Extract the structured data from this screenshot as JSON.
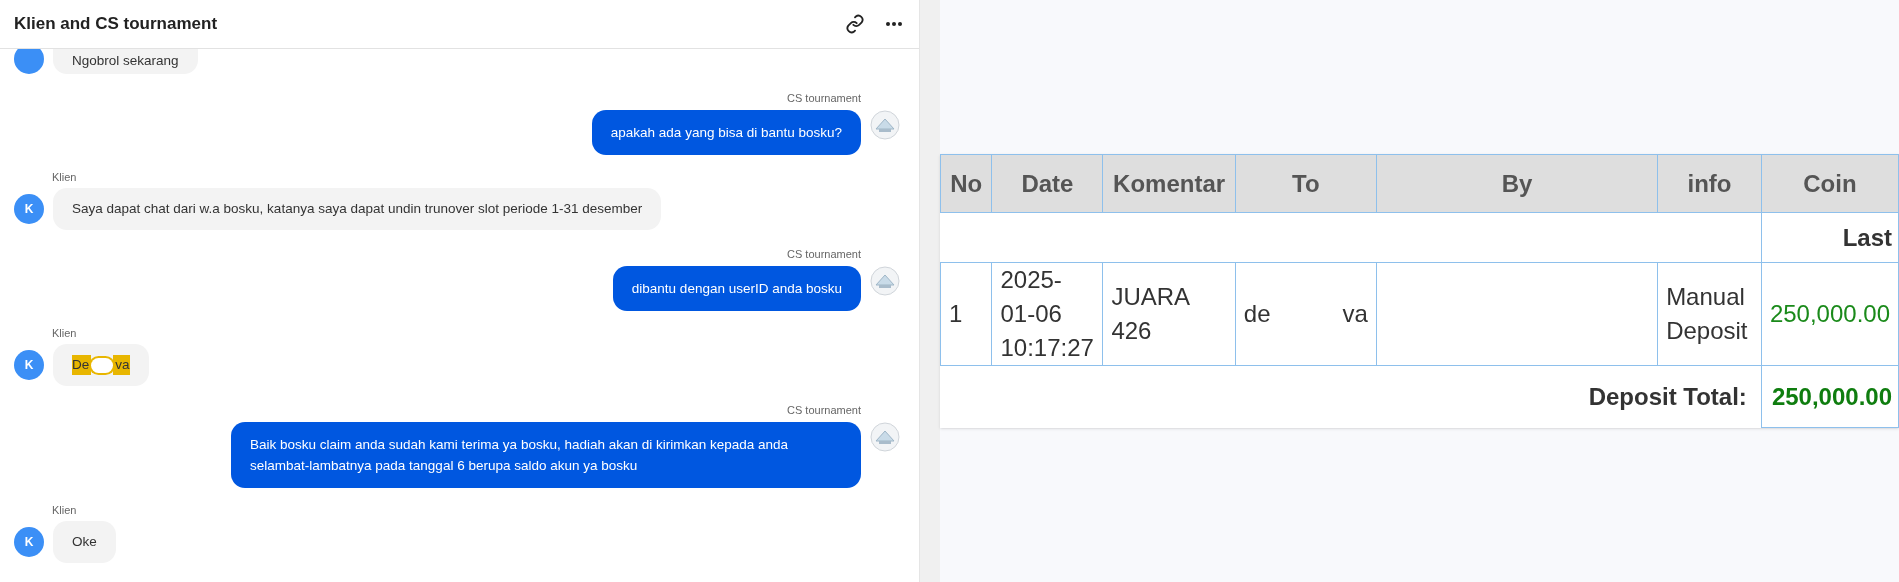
{
  "chat": {
    "title": "Klien and CS tournament",
    "messages": [
      {
        "outgoing": false,
        "kind": "text",
        "text": "Ngobrol sekarang"
      },
      {
        "outgoing": true,
        "sender": "CS tournament",
        "kind": "text",
        "text": "apakah ada yang bisa di bantu bosku?"
      },
      {
        "outgoing": false,
        "sender": "Klien",
        "avatar": "K",
        "kind": "text",
        "text": "Saya dapat chat dari w.a bosku, katanya saya dapat undin trunover slot periode 1-31 desember"
      },
      {
        "outgoing": true,
        "sender": "CS tournament",
        "kind": "text",
        "text": "dibantu dengan userID anda bosku"
      },
      {
        "outgoing": false,
        "sender": "Klien",
        "avatar": "K",
        "kind": "redacted",
        "before": "De",
        "after": "va"
      },
      {
        "outgoing": true,
        "sender": "CS tournament",
        "kind": "text",
        "text": "Baik bosku claim anda sudah kami terima ya bosku, hadiah akan di kirimkan kepada anda selambat-lambatnya pada tanggal 6 berupa saldo akun ya bosku"
      },
      {
        "outgoing": false,
        "sender": "Klien",
        "avatar": "K",
        "kind": "text",
        "text": "Oke"
      }
    ]
  },
  "table": {
    "columns": [
      "No",
      "Date",
      "Komentar",
      "To",
      "By",
      "info",
      "Coin"
    ],
    "group_label": "Last",
    "rows": [
      {
        "no": "1",
        "date": "2025-01-06 10:17:27",
        "komentar": "JUARA 426",
        "to_start": "de",
        "to_end": "va",
        "info": "Manual Deposit",
        "coin": "250,000.00"
      }
    ],
    "total_label": "Deposit Total:",
    "total": "250,000.00"
  }
}
